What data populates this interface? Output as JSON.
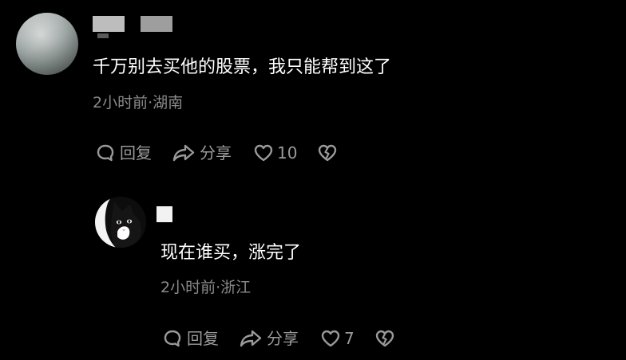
{
  "comment": {
    "text": "千万别去买他的股票，我只能帮到这了",
    "meta": "2小时前·湖南",
    "reply_label": "回复",
    "share_label": "分享",
    "like_count": "10",
    "icons": {
      "reply": "comment-bubble-icon",
      "share": "share-arrow-icon",
      "like": "heart-icon",
      "dislike": "broken-heart-icon"
    }
  },
  "reply": {
    "text": "现在谁买，涨完了",
    "meta": "2小时前·浙江",
    "reply_label": "回复",
    "share_label": "分享",
    "like_count": "7"
  },
  "colors": {
    "background": "#000000",
    "primary_text": "#ffffff",
    "secondary_text": "#8a8a8a",
    "action_text": "#9a9a9a"
  }
}
